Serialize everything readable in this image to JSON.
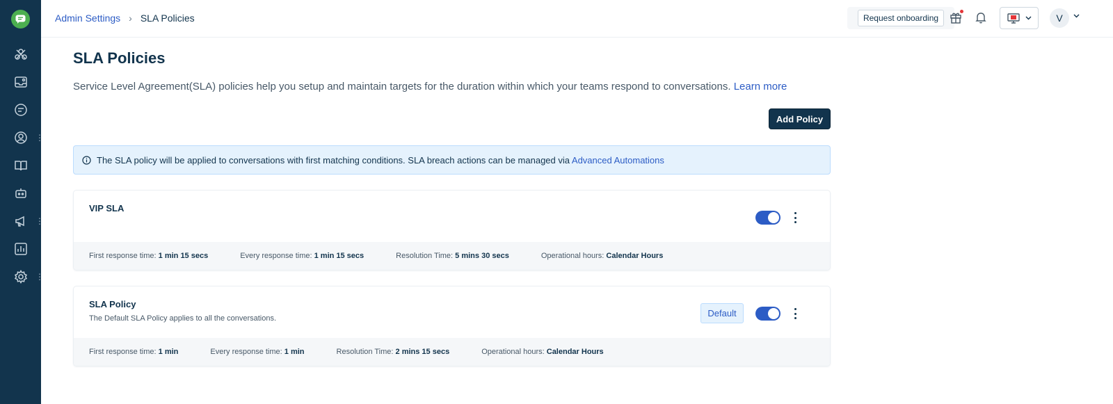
{
  "breadcrumb": {
    "parent": "Admin Settings",
    "separator": "›",
    "current": "SLA Policies"
  },
  "header": {
    "onboarding_label": "Request onboarding",
    "avatar_initial": "V"
  },
  "page": {
    "title": "SLA Policies",
    "description": "Service Level Agreement(SLA) policies help you setup and maintain targets for the duration within which your teams respond to conversations.",
    "learn_more": "Learn more",
    "add_button": "Add Policy"
  },
  "info_banner": {
    "text": "The SLA policy will be applied to conversations with first matching conditions. SLA breach actions can be managed via",
    "link": "Advanced Automations"
  },
  "policies": [
    {
      "name": "VIP SLA",
      "subtitle": "",
      "enabled": true,
      "badge": "",
      "metrics": {
        "first_label": "First response time:",
        "first_value": "1 min 15 secs",
        "every_label": "Every response time:",
        "every_value": "1 min 15 secs",
        "resolution_label": "Resolution Time:",
        "resolution_value": "5 mins 30 secs",
        "hours_label": "Operational hours:",
        "hours_value": "Calendar Hours"
      }
    },
    {
      "name": "SLA Policy",
      "subtitle": "The Default SLA Policy applies to all the conversations.",
      "enabled": true,
      "badge": "Default",
      "metrics": {
        "first_label": "First response time:",
        "first_value": "1 min",
        "every_label": "Every response time:",
        "every_value": "1 min",
        "resolution_label": "Resolution Time:",
        "resolution_value": "2 mins 15 secs",
        "hours_label": "Operational hours:",
        "hours_value": "Calendar Hours"
      }
    }
  ],
  "sidebar": {
    "icons": [
      "logo-icon",
      "network-icon",
      "inbox-icon",
      "conversations-icon",
      "contacts-icon",
      "knowledge-base-icon",
      "bot-icon",
      "campaigns-icon",
      "reports-icon",
      "settings-icon"
    ]
  },
  "colors": {
    "sidebar": "#12344d",
    "accent": "#2c5cc5",
    "brand": "#4caf50",
    "info_bg": "#e5f2fd"
  }
}
